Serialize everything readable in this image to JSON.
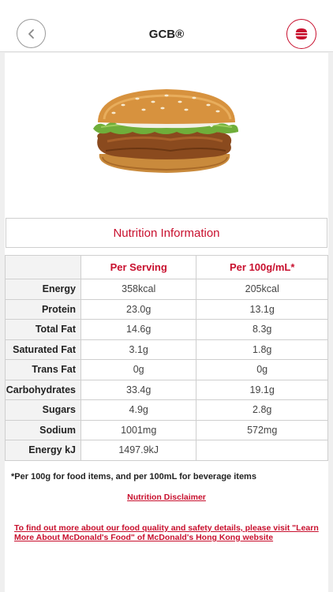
{
  "header": {
    "title": "GCB®",
    "back_icon": "chevron-left-icon",
    "menu_icon": "burger-icon",
    "accent_color": "#c8102e"
  },
  "product_image": "burger-image",
  "nutrition": {
    "title": "Nutrition Information",
    "columns": [
      "Per Serving",
      "Per 100g/mL*"
    ],
    "rows": [
      {
        "label": "Energy",
        "per_serving": "358kcal",
        "per_100": "205kcal"
      },
      {
        "label": "Protein",
        "per_serving": "23.0g",
        "per_100": "13.1g"
      },
      {
        "label": "Total Fat",
        "per_serving": "14.6g",
        "per_100": "8.3g"
      },
      {
        "label": "Saturated Fat",
        "per_serving": "3.1g",
        "per_100": "1.8g"
      },
      {
        "label": "Trans Fat",
        "per_serving": "0g",
        "per_100": "0g"
      },
      {
        "label": "Carbohydrates",
        "per_serving": "33.4g",
        "per_100": "19.1g"
      },
      {
        "label": "Sugars",
        "per_serving": "4.9g",
        "per_100": "2.8g"
      },
      {
        "label": "Sodium",
        "per_serving": "1001mg",
        "per_100": "572mg"
      },
      {
        "label": "Energy kJ",
        "per_serving": "1497.9kJ",
        "per_100": ""
      }
    ]
  },
  "footnote": "*Per 100g for food items, and per 100mL for beverage items",
  "disclaimer_link": "Nutrition Disclaimer",
  "more_info_link": "To find out more about our food quality and safety details, please visit \"Learn More About McDonald's Food\" of McDonald's Hong Kong website"
}
